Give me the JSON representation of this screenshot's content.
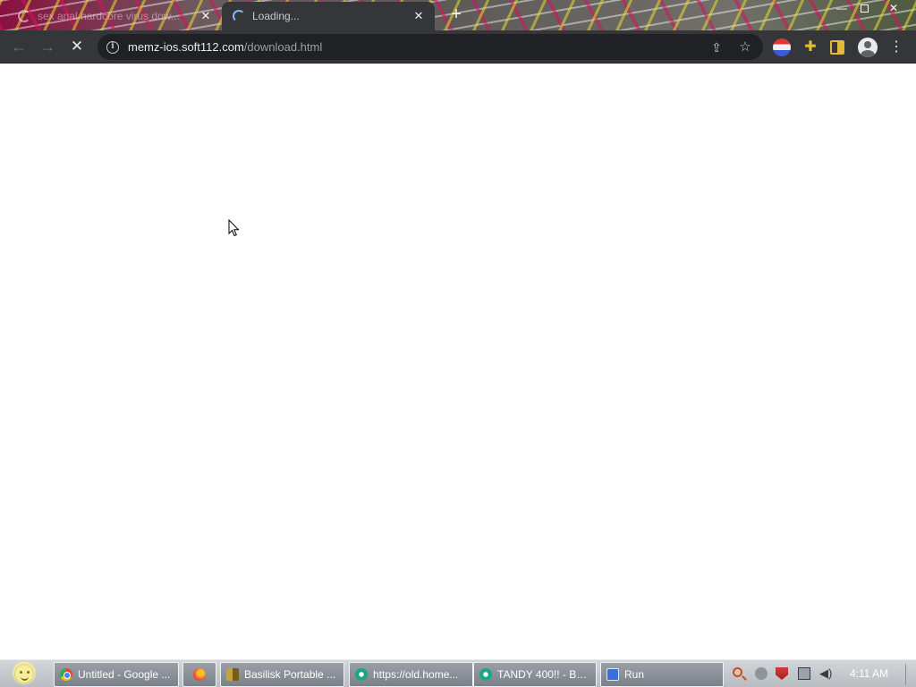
{
  "browser": {
    "tabs": [
      {
        "title": "sex anal hardcore virus dow..."
      },
      {
        "title": "Loading..."
      }
    ],
    "new_tab_symbol": "+",
    "address_bar": {
      "host": "memz-ios.soft112.com",
      "path": "/download.html"
    }
  },
  "taskbar": {
    "buttons": [
      {
        "label": "Untitled - Google ...",
        "icon": "chrome-icon"
      },
      {
        "label": "",
        "icon": "firefox-icon"
      },
      {
        "label": "Basilisk Portable ...",
        "icon": "basilisk-icon"
      },
      {
        "label": "https://old.home...",
        "icon": "edge-icon"
      },
      {
        "label": "TANDY 400!! - Ba...",
        "icon": "edge-icon"
      },
      {
        "label": "Run",
        "icon": "run-icon"
      }
    ],
    "clock": "4:11 AM"
  }
}
